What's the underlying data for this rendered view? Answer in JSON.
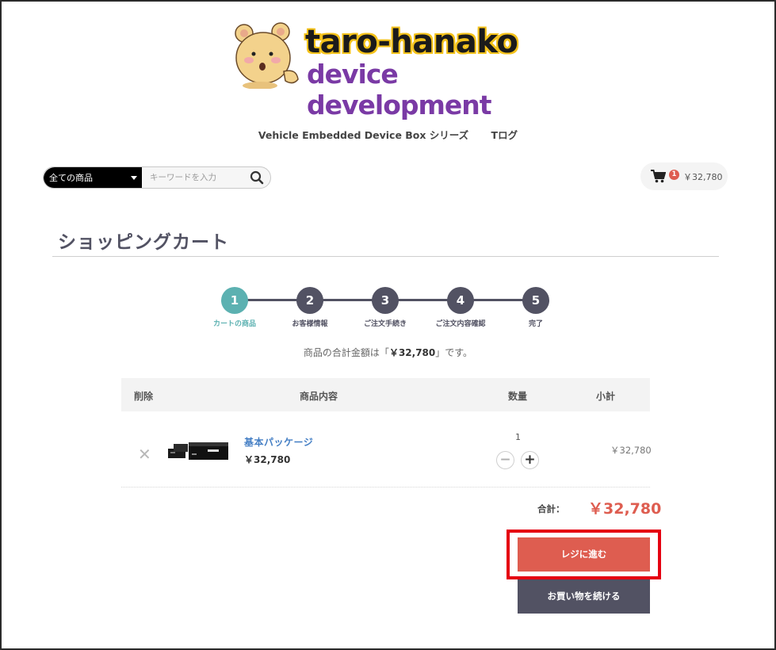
{
  "logo": {
    "line1": "taro-hanako",
    "line2": "device development"
  },
  "nav": {
    "items": [
      "Vehicle Embedded Device Box シリーズ",
      "Tログ"
    ]
  },
  "search": {
    "category": "全ての商品",
    "placeholder": "キーワードを入力"
  },
  "cart_summary": {
    "count": "1",
    "total": "￥32,780"
  },
  "page": {
    "title": "ショッピングカート"
  },
  "steps": [
    {
      "num": "1",
      "label": "カートの商品",
      "active": true
    },
    {
      "num": "2",
      "label": "お客様情報",
      "active": false
    },
    {
      "num": "3",
      "label": "ご注文手続き",
      "active": false
    },
    {
      "num": "4",
      "label": "ご注文内容確認",
      "active": false
    },
    {
      "num": "5",
      "label": "完了",
      "active": false
    }
  ],
  "total_message": {
    "prefix": "商品の合計金額は「",
    "amount": "￥32,780",
    "suffix": "」です。"
  },
  "table": {
    "headers": {
      "delete": "削除",
      "content": "商品内容",
      "qty": "数量",
      "subtotal": "小計"
    },
    "rows": [
      {
        "name": "基本パッケージ",
        "price": "￥32,780",
        "qty": "1",
        "subtotal": "￥32,780"
      }
    ]
  },
  "summary": {
    "label": "合計：",
    "value": "￥32,780"
  },
  "buttons": {
    "checkout": "レジに進む",
    "continue": "お買い物を続ける"
  },
  "colors": {
    "accent": "#5cb1b1",
    "primary": "#525263",
    "checkout": "#de5d50",
    "highlight": "#e50011"
  }
}
